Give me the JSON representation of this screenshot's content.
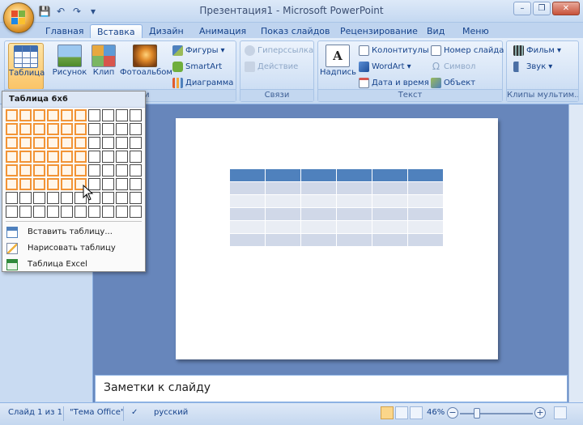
{
  "window": {
    "title": "Презентация1 - Microsoft PowerPoint",
    "controls": {
      "minimize": "–",
      "maximize": "❐",
      "close": "✕"
    }
  },
  "qat": {
    "save": "💾",
    "undo": "↶",
    "redo": "↷",
    "customize": "▾"
  },
  "tabs": [
    "Главная",
    "Вставка",
    "Дизайн",
    "Анимация",
    "Показ слайдов",
    "Рецензирование",
    "Вид",
    "Меню"
  ],
  "active_tab": "Вставка",
  "ribbon": {
    "table_btn": "Таблица",
    "picture_btn": "Рисунок",
    "clip_btn": "Клип",
    "album_btn": "Фотоальбом",
    "shapes_btn": "Фигуры",
    "smartart_btn": "SmartArt",
    "chart_btn": "Диаграмма",
    "illustrations_label": "Иллюстрации",
    "hyperlink_btn": "Гиперссылка",
    "action_btn": "Действие",
    "links_label": "Связи",
    "textbox_btn": "Надпись",
    "headerfooter_btn": "Колонтитулы",
    "wordart_btn": "WordArt",
    "datetime_btn": "Дата и время",
    "slidenum_btn": "Номер слайда",
    "symbol_btn": "Символ",
    "object_btn": "Объект",
    "text_label": "Текст",
    "movie_btn": "Фильм",
    "sound_btn": "Звук",
    "media_label": "Клипы мультим..."
  },
  "dropdown": {
    "title": "Таблица 6x6",
    "grid_rows": 8,
    "grid_cols": 10,
    "selected_rows": 6,
    "selected_cols": 6,
    "items": [
      {
        "label": "Вставить таблицу...",
        "icon": "table-insert-icon"
      },
      {
        "label": "Нарисовать таблицу",
        "icon": "pencil-table-icon"
      },
      {
        "label": "Таблица Excel",
        "icon": "excel-table-icon"
      }
    ]
  },
  "slide_table": {
    "rows": 6,
    "cols": 6
  },
  "notes": {
    "placeholder": "Заметки к слайду"
  },
  "status": {
    "slide_info": "Слайд 1 из 1",
    "theme": "\"Тема Office\"",
    "language": "русский",
    "zoom": "46%"
  },
  "colors": {
    "accent_orange": "#f29436",
    "table_header": "#4f81bd",
    "table_band_dark": "#d0d8e8",
    "table_band_light": "#e9edf4"
  }
}
